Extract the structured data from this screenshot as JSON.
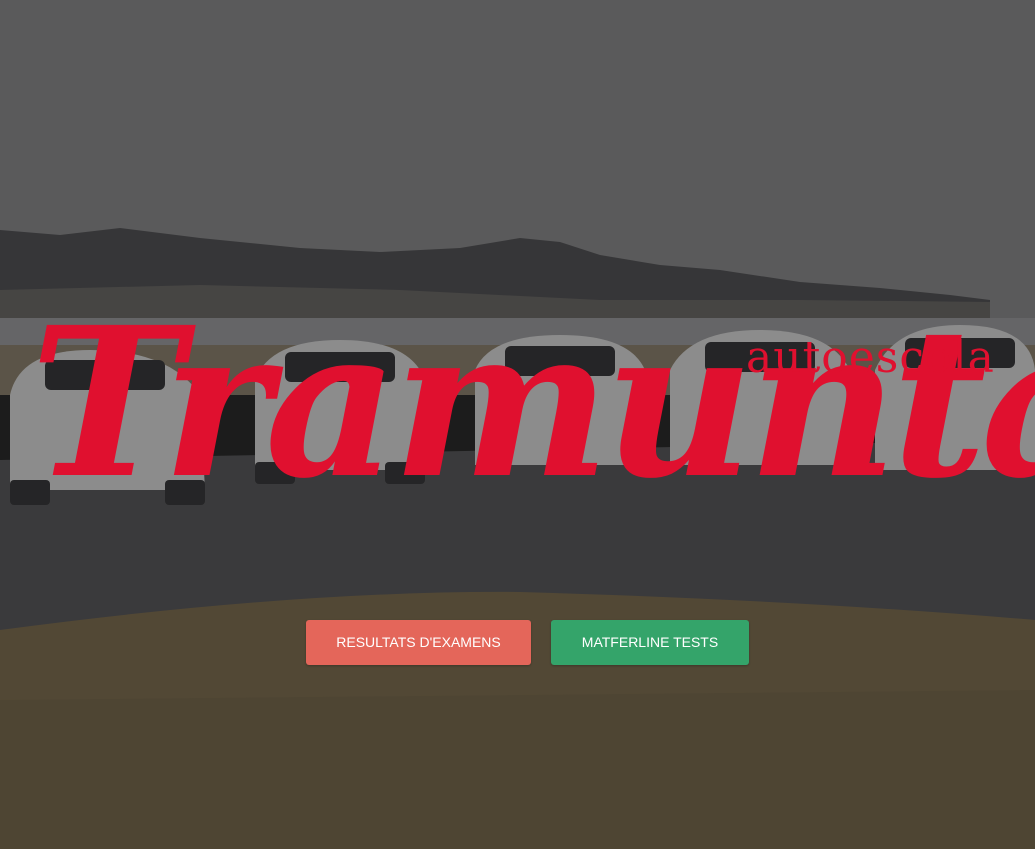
{
  "logo": {
    "script_text": "Tramuntana",
    "subtitle": "autoescola"
  },
  "buttons": {
    "results_label": "RESULTATS D'EXAMENS",
    "tests_label": "MATFERLINE TESTS"
  },
  "colors": {
    "brand_red": "#e0102f",
    "results_button": "#e4665a",
    "tests_button": "#34a46a"
  }
}
